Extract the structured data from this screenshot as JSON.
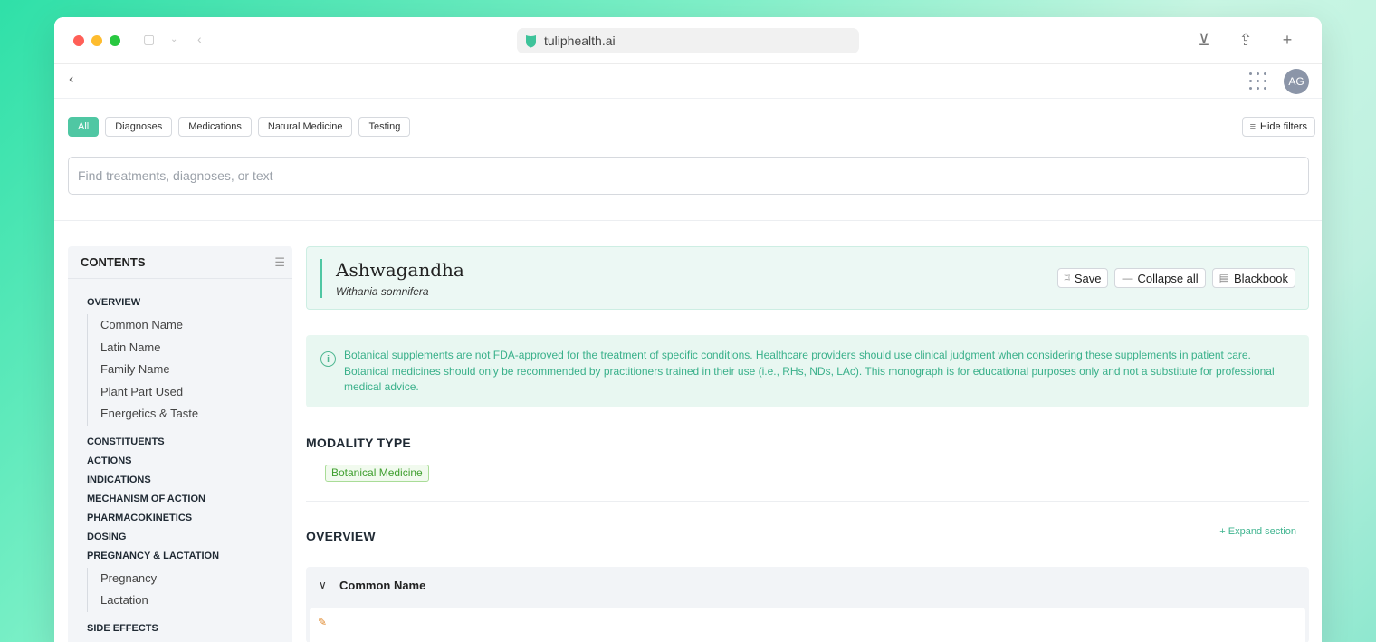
{
  "browser": {
    "url": "tuliphealth.ai"
  },
  "appbar": {
    "back": "‹",
    "avatar_initials": "AG"
  },
  "filters": {
    "chips": [
      "All",
      "Diagnoses",
      "Medications",
      "Natural Medicine",
      "Testing"
    ],
    "active": "All",
    "hide_label": "Hide filters"
  },
  "search": {
    "placeholder": "Find treatments, diagnoses, or text"
  },
  "sidebar": {
    "title": "CONTENTS",
    "overview": "OVERVIEW",
    "overview_items": [
      "Common Name",
      "Latin Name",
      "Family Name",
      "Plant Part Used",
      "Energetics & Taste"
    ],
    "sections": [
      "CONSTITUENTS",
      "ACTIONS",
      "INDICATIONS",
      "MECHANISM OF ACTION",
      "PHARMACOKINETICS",
      "DOSING",
      "PREGNANCY & LACTATION"
    ],
    "pregnancy_items": [
      "Pregnancy",
      "Lactation"
    ],
    "side_effects": "SIDE EFFECTS"
  },
  "monograph": {
    "name": "Ashwagandha",
    "latin": "Withania somnifera",
    "save_label": "Save",
    "collapse_label": "Collapse all",
    "blackbook_label": "Blackbook",
    "notice": "Botanical supplements are not FDA-approved for the treatment of specific conditions. Healthcare providers should use clinical judgment when considering these supplements in patient care. Botanical medicines should only be recommended by practitioners trained in their use (i.e., RHs, NDs, LAc). This monograph is for educational purposes only and not a substitute for professional medical advice.",
    "modality_heading": "MODALITY TYPE",
    "modality_tag": "Botanical Medicine",
    "overview_heading": "OVERVIEW",
    "expand_label": "+ Expand section",
    "common_name_label": "Common Name"
  },
  "colors": {
    "accent": "#4fc7a3",
    "notice_text": "#39b08a",
    "tag_green": "#3f9f2f"
  }
}
